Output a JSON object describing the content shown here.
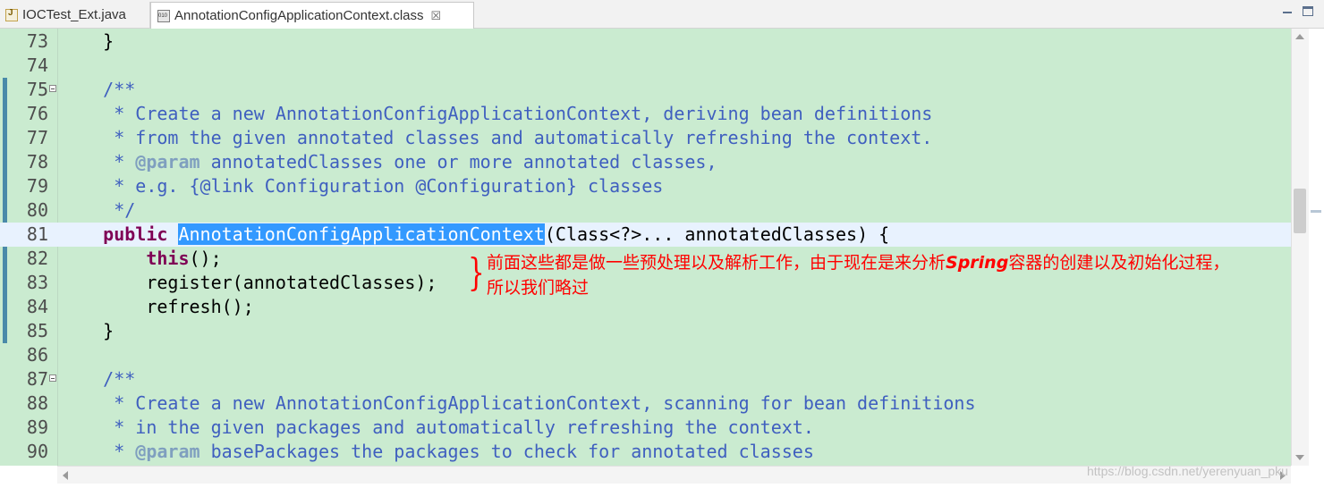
{
  "tabs": [
    {
      "label": "IOCTest_Ext.java",
      "icon": "java-file-icon",
      "active": false
    },
    {
      "label": "AnnotationConfigApplicationContext.class",
      "icon": "class-file-icon",
      "active": true,
      "close": "☒"
    }
  ],
  "editor": {
    "lines": [
      {
        "n": "73",
        "segs": [
          {
            "t": "    }",
            "c": "plain"
          }
        ]
      },
      {
        "n": "74",
        "segs": []
      },
      {
        "n": "75",
        "fold": true,
        "segs": [
          {
            "t": "    /**",
            "c": "cm"
          }
        ]
      },
      {
        "n": "76",
        "segs": [
          {
            "t": "     * Create a new AnnotationConfigApplicationContext, deriving bean definitions",
            "c": "cm"
          }
        ]
      },
      {
        "n": "77",
        "segs": [
          {
            "t": "     * from the given annotated classes and automatically refreshing the context.",
            "c": "cm"
          }
        ]
      },
      {
        "n": "78",
        "segs": [
          {
            "t": "     * ",
            "c": "cm"
          },
          {
            "t": "@param",
            "c": "tag"
          },
          {
            "t": " annotatedClasses one or more annotated classes,",
            "c": "cm"
          }
        ]
      },
      {
        "n": "79",
        "segs": [
          {
            "t": "     * e.g. {@link Configuration @Configuration} classes",
            "c": "cm"
          }
        ]
      },
      {
        "n": "80",
        "segs": [
          {
            "t": "     */",
            "c": "cm"
          }
        ]
      },
      {
        "n": "81",
        "current": true,
        "segs": [
          {
            "t": "    ",
            "c": "plain"
          },
          {
            "t": "public",
            "c": "kw"
          },
          {
            "t": " ",
            "c": "plain"
          },
          {
            "t": "AnnotationConfigApplicationContext",
            "c": "hl"
          },
          {
            "t": "(Class<?>... annotatedClasses) {",
            "c": "plain"
          }
        ]
      },
      {
        "n": "82",
        "segs": [
          {
            "t": "        ",
            "c": "plain"
          },
          {
            "t": "this",
            "c": "kw"
          },
          {
            "t": "();",
            "c": "plain"
          }
        ]
      },
      {
        "n": "83",
        "segs": [
          {
            "t": "        register(annotatedClasses);",
            "c": "plain"
          }
        ]
      },
      {
        "n": "84",
        "segs": [
          {
            "t": "        refresh();",
            "c": "plain"
          }
        ]
      },
      {
        "n": "85",
        "segs": [
          {
            "t": "    }",
            "c": "plain"
          }
        ]
      },
      {
        "n": "86",
        "segs": []
      },
      {
        "n": "87",
        "fold": true,
        "segs": [
          {
            "t": "    /**",
            "c": "cm"
          }
        ]
      },
      {
        "n": "88",
        "segs": [
          {
            "t": "     * Create a new AnnotationConfigApplicationContext, scanning for bean definitions",
            "c": "cm"
          }
        ]
      },
      {
        "n": "89",
        "segs": [
          {
            "t": "     * in the given packages and automatically refreshing the context.",
            "c": "cm"
          }
        ]
      },
      {
        "n": "90",
        "segs": [
          {
            "t": "     * ",
            "c": "cm"
          },
          {
            "t": "@param",
            "c": "tag"
          },
          {
            "t": " basePackages the packages to check for annotated classes",
            "c": "cm"
          }
        ]
      }
    ]
  },
  "annotation": {
    "brace": "}",
    "text_before": "前面这些都是做一些预处理以及解析工作，由于现在是来分析",
    "text_spring": "Spring",
    "text_after": "容器的创建以及初始化过程，所以我们略过"
  },
  "watermark": "https://blog.csdn.net/yerenyuan_pku",
  "colors": {
    "editor_bg": "#caebd0",
    "current_line": "#e8f2fe",
    "selection": "#3399ff",
    "comment": "#3f5fbf",
    "keyword": "#7f0055",
    "annotation": "#ff0000"
  }
}
